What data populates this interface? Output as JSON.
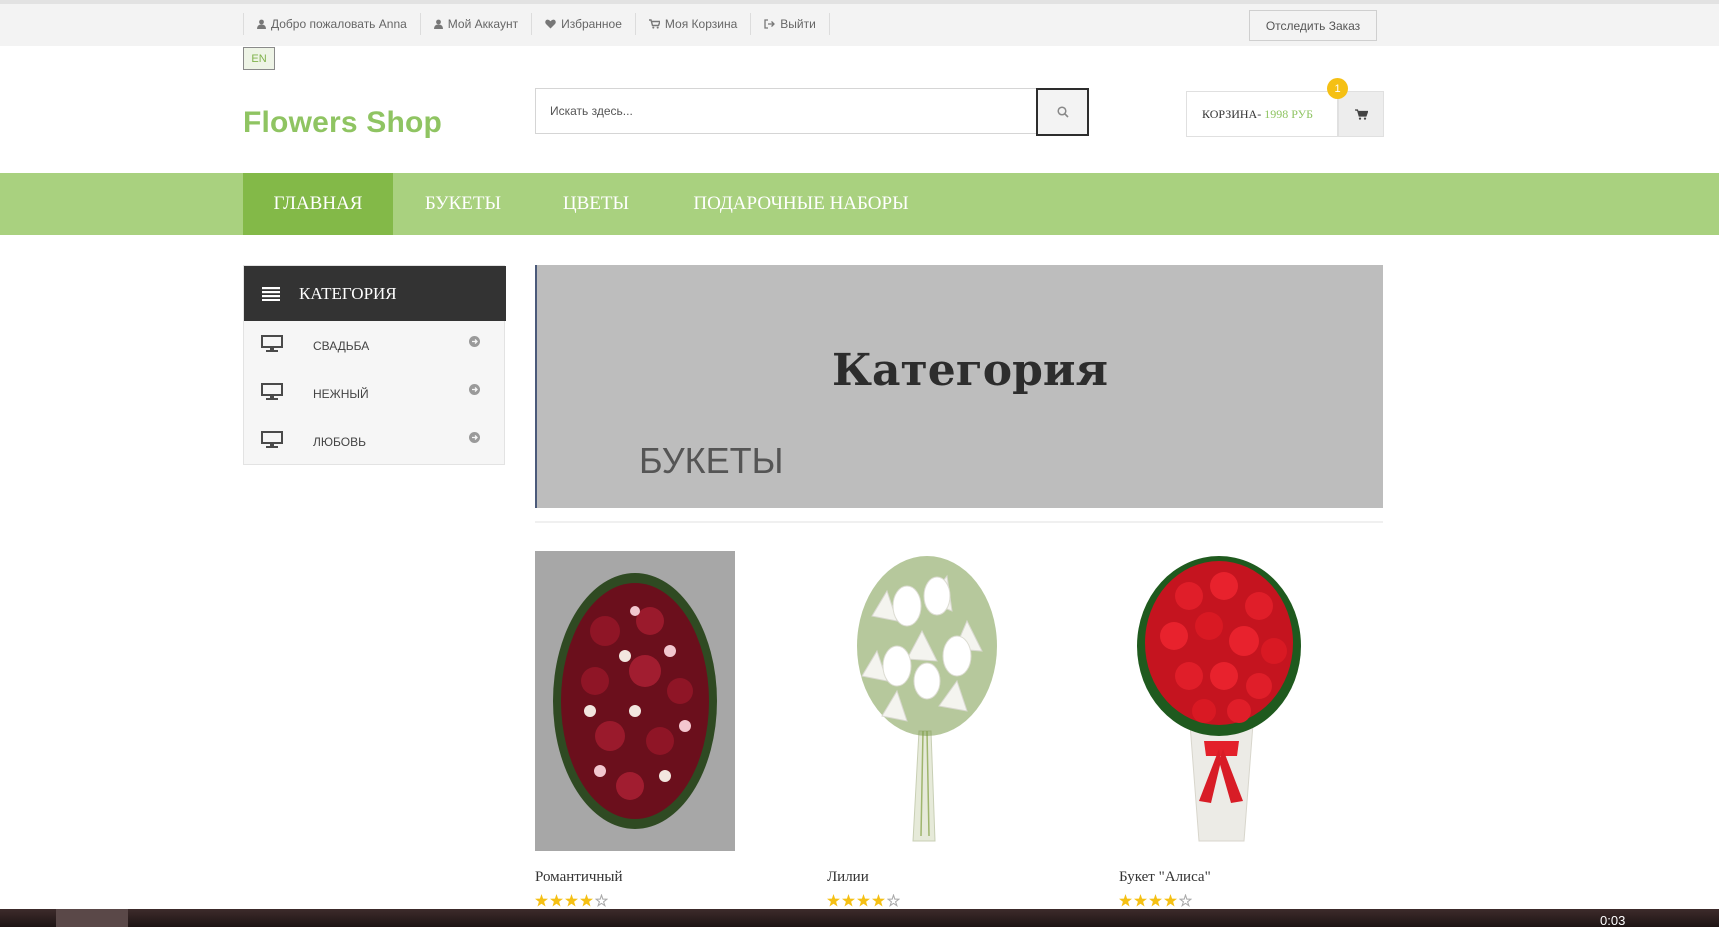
{
  "topbar": {
    "links": [
      {
        "label": "Добро пожаловать Anna",
        "icon": "user-icon"
      },
      {
        "label": "Мой Аккаунт",
        "icon": "user-icon"
      },
      {
        "label": "Избранное",
        "icon": "heart-icon"
      },
      {
        "label": "Моя Корзина",
        "icon": "cart-icon"
      },
      {
        "label": "Выйти",
        "icon": "sign-out-icon"
      }
    ],
    "track_order": "Отследить Заказ",
    "language": "EN"
  },
  "header": {
    "logo": "Flowers Shop",
    "search_placeholder": "Искать здесь...",
    "cart_label": "КОРЗИНА-",
    "cart_price": "1998 РУБ",
    "cart_count": "1"
  },
  "nav": {
    "items": [
      "ГЛАВНАЯ",
      "БУКЕТЫ",
      "ЦВЕТЫ",
      "ПОДАРОЧНЫЕ НАБОРЫ"
    ],
    "active": "ГЛАВНАЯ"
  },
  "sidebar": {
    "title": "КАТЕГОРИЯ",
    "items": [
      "СВАДЬБА",
      "НЕЖНЫЙ",
      "ЛЮБОВЬ"
    ]
  },
  "banner": {
    "title": "Категория",
    "subtitle": "БУКЕТЫ"
  },
  "products": [
    {
      "name": "Романтичный",
      "rating": 4,
      "max_rating": 5
    },
    {
      "name": "Лилии",
      "rating": 4,
      "max_rating": 5
    },
    {
      "name": "Букет \"Алиса\"",
      "rating": 4,
      "max_rating": 5
    }
  ],
  "taskbar": {
    "time": "0:03"
  },
  "colors": {
    "accent_green": "#a9d17f",
    "active_green": "#83b948",
    "logo_green": "#8fc462",
    "badge_yellow": "#f5c014",
    "sidebar_dark": "#333333"
  }
}
